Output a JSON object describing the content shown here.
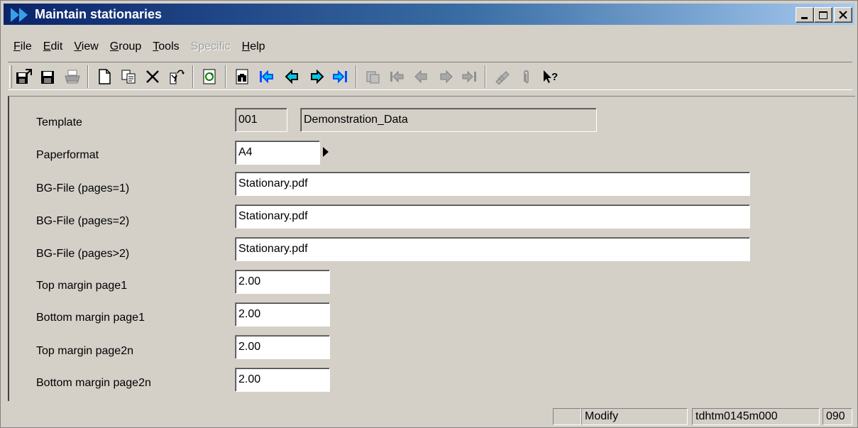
{
  "window": {
    "title": "Maintain stationaries"
  },
  "menu": [
    {
      "label": "File",
      "u": "F",
      "rest": "ile",
      "disabled": false
    },
    {
      "label": "Edit",
      "u": "E",
      "rest": "dit",
      "disabled": false
    },
    {
      "label": "View",
      "u": "V",
      "rest": "iew",
      "disabled": false
    },
    {
      "label": "Group",
      "u": "G",
      "rest": "roup",
      "disabled": false
    },
    {
      "label": "Tools",
      "u": "T",
      "rest": "ools",
      "disabled": false
    },
    {
      "label": "Specific",
      "u": "S",
      "rest": "pecific",
      "disabled": true
    },
    {
      "label": "Help",
      "u": "H",
      "rest": "elp",
      "disabled": false
    }
  ],
  "toolbar_icons": [
    "save-and-exit-icon",
    "save-icon",
    "print-icon",
    "new-icon",
    "copy-icon",
    "delete-icon",
    "mark-icon",
    "refresh-icon",
    "find-icon",
    "first-record-icon",
    "previous-record-icon",
    "next-record-icon",
    "last-record-icon",
    "group-icon",
    "first-group-icon",
    "previous-group-icon",
    "next-group-icon",
    "last-group-icon",
    "notes-icon",
    "attachment-icon",
    "context-help-icon"
  ],
  "form": {
    "template": {
      "label": "Template",
      "code": "001",
      "description": "Demonstration_Data"
    },
    "paperformat": {
      "label": "Paperformat",
      "value": "A4"
    },
    "bg_file_1": {
      "label": "BG-File (pages=1)",
      "value": "Stationary.pdf"
    },
    "bg_file_2": {
      "label": "BG-File (pages=2)",
      "value": "Stationary.pdf"
    },
    "bg_file_3": {
      "label": "BG-File (pages>2)",
      "value": "Stationary.pdf"
    },
    "top_margin_1": {
      "label": "Top margin page1",
      "value": "2.00"
    },
    "bottom_margin_1": {
      "label": "Bottom margin page1",
      "value": "2.00"
    },
    "top_margin_2n": {
      "label": "Top margin page2n",
      "value": "2.00"
    },
    "bottom_margin_2n": {
      "label": "Bottom margin page2n",
      "value": "2.00"
    }
  },
  "status": {
    "empty": "",
    "mode": "Modify",
    "session": "tdhtm0145m000",
    "company": "090"
  },
  "colors": {
    "title_start": "#0a246a",
    "title_end": "#a6caf0",
    "face": "#d4d0c8",
    "arrow_cyan": "#00c8e0",
    "arrow_blue": "#0050ff"
  }
}
